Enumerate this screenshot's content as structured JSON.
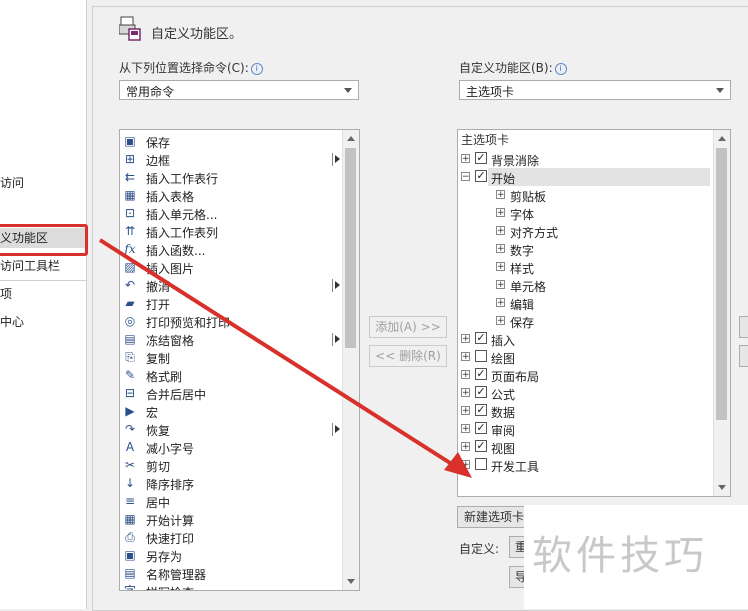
{
  "nav": {
    "items": [
      "访问",
      "义功能区",
      "访问工具栏",
      "项",
      "中心"
    ],
    "active_index": 1
  },
  "header": {
    "title": "自定义功能区。"
  },
  "left_panel": {
    "label": "从下列位置选择命令(C):",
    "info": "i",
    "dropdown_value": "常用命令",
    "commands": [
      {
        "icon": "save-icon",
        "glyph": "▣",
        "label": "保存",
        "submenu": false
      },
      {
        "icon": "border-icon",
        "glyph": "⊞",
        "label": "边框",
        "submenu": true
      },
      {
        "icon": "insert-row-icon",
        "glyph": "⇇",
        "label": "插入工作表行",
        "submenu": false
      },
      {
        "icon": "insert-table-icon",
        "glyph": "▦",
        "label": "插入表格",
        "submenu": false
      },
      {
        "icon": "insert-cell-icon",
        "glyph": "⊡",
        "label": "插入单元格...",
        "submenu": false
      },
      {
        "icon": "insert-column-icon",
        "glyph": "⇈",
        "label": "插入工作表列",
        "submenu": false
      },
      {
        "icon": "function-icon",
        "glyph": "fx",
        "label": "插入函数...",
        "submenu": false
      },
      {
        "icon": "picture-icon",
        "glyph": "▨",
        "label": "插入图片",
        "submenu": false
      },
      {
        "icon": "undo-icon",
        "glyph": "↶",
        "label": "撤消",
        "submenu": true
      },
      {
        "icon": "open-icon",
        "glyph": "▰",
        "label": "打开",
        "submenu": false
      },
      {
        "icon": "print-preview-icon",
        "glyph": "◎",
        "label": "打印预览和打印",
        "submenu": false
      },
      {
        "icon": "freeze-icon",
        "glyph": "▤",
        "label": "冻结窗格",
        "submenu": true
      },
      {
        "icon": "copy-icon",
        "glyph": "⎘",
        "label": "复制",
        "submenu": false
      },
      {
        "icon": "format-painter-icon",
        "glyph": "✎",
        "label": "格式刷",
        "submenu": false
      },
      {
        "icon": "merge-icon",
        "glyph": "⊟",
        "label": "合并后居中",
        "submenu": false
      },
      {
        "icon": "macro-icon",
        "glyph": "▶",
        "label": "宏",
        "submenu": false
      },
      {
        "icon": "redo-icon",
        "glyph": "↷",
        "label": "恢复",
        "submenu": true
      },
      {
        "icon": "decrease-font-icon",
        "glyph": "A",
        "label": "减小字号",
        "submenu": false
      },
      {
        "icon": "cut-icon",
        "glyph": "✂",
        "label": "剪切",
        "submenu": false
      },
      {
        "icon": "sort-desc-icon",
        "glyph": "↓",
        "label": "降序排序",
        "submenu": false
      },
      {
        "icon": "center-icon",
        "glyph": "≡",
        "label": "居中",
        "submenu": false
      },
      {
        "icon": "calculate-icon",
        "glyph": "▦",
        "label": "开始计算",
        "submenu": false
      },
      {
        "icon": "quick-print-icon",
        "glyph": "⎙",
        "label": "快速打印",
        "submenu": false
      },
      {
        "icon": "save-as-icon",
        "glyph": "▣",
        "label": "另存为",
        "submenu": false
      },
      {
        "icon": "name-manager-icon",
        "glyph": "▤",
        "label": "名称管理器",
        "submenu": false
      },
      {
        "icon": "spell-check-icon",
        "glyph": "字",
        "label": "拼写检查",
        "submenu": false
      }
    ]
  },
  "middle": {
    "add_button": "添加(A) >>",
    "remove_button": "<< 删除(R)"
  },
  "right_panel": {
    "label": "自定义功能区(B):",
    "info": "i",
    "dropdown_value": "主选项卡",
    "tree_header": "主选项卡",
    "tree": [
      {
        "level": 0,
        "expander": "+",
        "checked": true,
        "label": "背景消除",
        "selected": false
      },
      {
        "level": 0,
        "expander": "−",
        "checked": true,
        "label": "开始",
        "selected": true
      },
      {
        "level": 1,
        "expander": "+",
        "label": "剪贴板"
      },
      {
        "level": 1,
        "expander": "+",
        "label": "字体"
      },
      {
        "level": 1,
        "expander": "+",
        "label": "对齐方式"
      },
      {
        "level": 1,
        "expander": "+",
        "label": "数字"
      },
      {
        "level": 1,
        "expander": "+",
        "label": "样式"
      },
      {
        "level": 1,
        "expander": "+",
        "label": "单元格"
      },
      {
        "level": 1,
        "expander": "+",
        "label": "编辑"
      },
      {
        "level": 1,
        "expander": "+",
        "label": "保存"
      },
      {
        "level": 0,
        "expander": "+",
        "checked": true,
        "label": "插入",
        "selected": false
      },
      {
        "level": 0,
        "expander": "+",
        "checked": false,
        "label": "绘图",
        "selected": false
      },
      {
        "level": 0,
        "expander": "+",
        "checked": true,
        "label": "页面布局",
        "selected": false
      },
      {
        "level": 0,
        "expander": "+",
        "checked": true,
        "label": "公式",
        "selected": false
      },
      {
        "level": 0,
        "expander": "+",
        "checked": true,
        "label": "数据",
        "selected": false
      },
      {
        "level": 0,
        "expander": "+",
        "checked": true,
        "label": "审阅",
        "selected": false
      },
      {
        "level": 0,
        "expander": "+",
        "checked": true,
        "label": "视图",
        "selected": false
      },
      {
        "level": 0,
        "expander": "+",
        "checked": false,
        "label": "开发工具",
        "selected": false
      }
    ],
    "new_tab_button": "新建选项卡",
    "customize_label": "自定义:",
    "reset_button": "重",
    "import_button": "导"
  },
  "annotation": {
    "arrow_color": "#d8302a"
  },
  "watermark": {
    "text": "软件技巧"
  }
}
